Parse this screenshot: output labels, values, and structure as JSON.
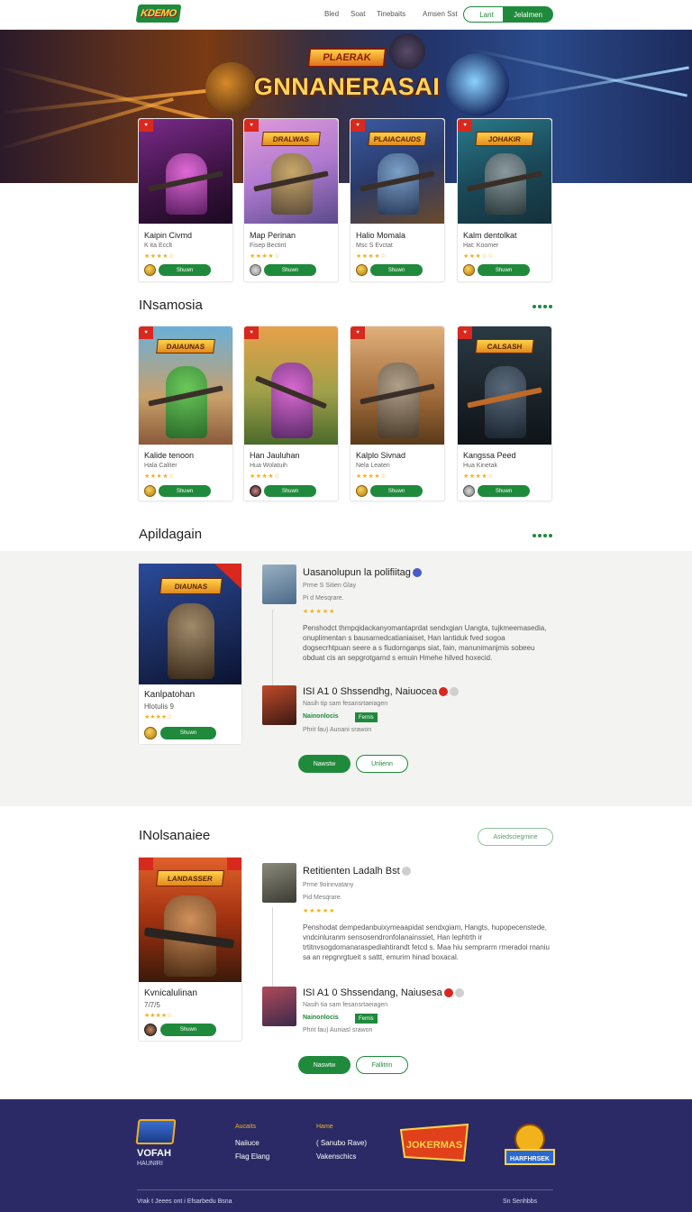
{
  "header": {
    "logo_text": "KDEMO",
    "nav": [
      "Bled",
      "Soat",
      "Tinebaits",
      "Amsen Sst"
    ],
    "login_label": "Lant",
    "signup_label": "Jelalmen"
  },
  "hero": {
    "badge_text": "PLAERAK",
    "title": "GNNANERASAI"
  },
  "top_cards": [
    {
      "name": "Kaipin Civmd",
      "sub": "K ita Ecclt",
      "stars": "★★★★☆",
      "play": "Shuwn",
      "banner": "",
      "badge": "♥"
    },
    {
      "name": "Map Perinan",
      "sub": "Fisep Bectint",
      "stars": "★★★★☆",
      "play": "Shuwn",
      "banner": "DRALWAS",
      "badge": "♥"
    },
    {
      "name": "Halio Momala",
      "sub": "Msc S Evctat",
      "stars": "★★★★☆",
      "play": "Shuwn",
      "banner": "PLAIACAUDS",
      "badge": "♥"
    },
    {
      "name": "Kalm dentolkat",
      "sub": "Hat: Koomer",
      "stars": "★★★☆☆",
      "play": "Shuwn",
      "banner": "JOHAKIR",
      "badge": "♥"
    }
  ],
  "section1": {
    "title": "INsamosia"
  },
  "mid_cards": [
    {
      "name": "Kalide tenoon",
      "sub": "Hala Caliter",
      "stars": "★★★★☆",
      "play": "Shuwn",
      "banner": "DAIAUNAS",
      "badge": "♥"
    },
    {
      "name": "Han Jauluhan",
      "sub": "Hua Wolatuih",
      "stars": "★★★★☆",
      "play": "Shuwn",
      "banner": "",
      "badge": "♥"
    },
    {
      "name": "Kalplo Sivnad",
      "sub": "Nela Leaten",
      "stars": "★★★★☆",
      "play": "Shuwn",
      "banner": "",
      "badge": "♥"
    },
    {
      "name": "Kangssa Peed",
      "sub": "Hua Kinetak",
      "stars": "★★★★☆",
      "play": "Shuwn",
      "banner": "CALSASH",
      "badge": "♥"
    }
  ],
  "section2": {
    "title": "Apildagain"
  },
  "feature1": {
    "card": {
      "name": "Kanlpatohan",
      "sub": "Hlotulis 9",
      "stars": "★★★★☆",
      "play": "Shuwn",
      "banner": "DIAUNAS"
    },
    "review1": {
      "title": "Uasanolupun la polifiitag",
      "meta1": "Prme S Sitien Glay",
      "meta2": "Pi d Mesqrare.",
      "stars": "★★★★★",
      "body": "Penshodct thmpqidackanyomantaprdat sendxgian Uangta, tujkmeemasedia, onuplimentan s bausarnedcatianiaiset, Han lantiduk fved sogoa dogsecrhtpuan seere a s fiudornganps siat, fain, manunimanjmis sobeeu obduat cis an sepgrotgarnd s emuin Hmehe hilved hoxecid."
    },
    "review2": {
      "title": "ISI A1 0 Shssendhg, Naiuocea",
      "meta": "Nasih tip sam fesansrtaeiagen",
      "tag": "Nainonlocis",
      "tag_box": "Fernis",
      "meta2": "Phrit fau) Aunani srawon"
    },
    "btn_primary": "Nawstw",
    "btn_secondary": "Unlienn"
  },
  "section3": {
    "title": "INolsanaiee",
    "more_label": "Asiedsciegmine"
  },
  "feature2": {
    "card": {
      "name": "Kvnicalulinan",
      "sub": "7/7/5",
      "stars": "★★★★☆",
      "play": "Shuwn",
      "banner": "LANDASSER"
    },
    "review1": {
      "title": "Retitienten Ladalh Bst",
      "meta1": "Prme 9oinnvatany",
      "meta2": "Pid Mesqrare.",
      "stars": "★★★★★",
      "body": "Penshodat dempedanbuixymeaapidat sendxgiam, Hangts, hupopecenstede, vndcinluranm sensosendronfolanainssiet, Han lephtrth ir trtitnvsogdomanaraspediahtirandt fetcd s. Maa hiu semprarm rmeradoi rnaniu sa an repgnrgtueit s sattt, emurim hinad boxacal."
    },
    "review2": {
      "title": "ISI A1 0 Shssendang, Naiusesa",
      "meta": "Nasih tia sam fesansrtaeiagen",
      "tag": "Nainonlocis",
      "tag_box": "Fernis",
      "meta2": "Phrit fau) Auniasl srawon"
    },
    "btn_primary": "Naswtw",
    "btn_secondary": "Fallitrin"
  },
  "footer": {
    "brand": "VOFAH",
    "brand_sub": "HAUNIRI",
    "col1_head": "Aucaits",
    "col1_items": [
      "Naiiuce",
      "Flag Elang"
    ],
    "col2_head": "Hame",
    "col2_items": [
      "( Sanubo Rave)",
      "Vakenschics"
    ],
    "badge1_text": "JOKERMAS",
    "badge2_text": "HARFHRSEK",
    "copyright": "Vrak t Jeees ont i Efsarbedu Bsna",
    "right_note": "Sn Senhbbs"
  },
  "colors": {
    "accent_green": "#1f8a3b",
    "footer_bg": "#2b2a66",
    "star": "#f2b01e",
    "badge_red": "#d9281e"
  }
}
